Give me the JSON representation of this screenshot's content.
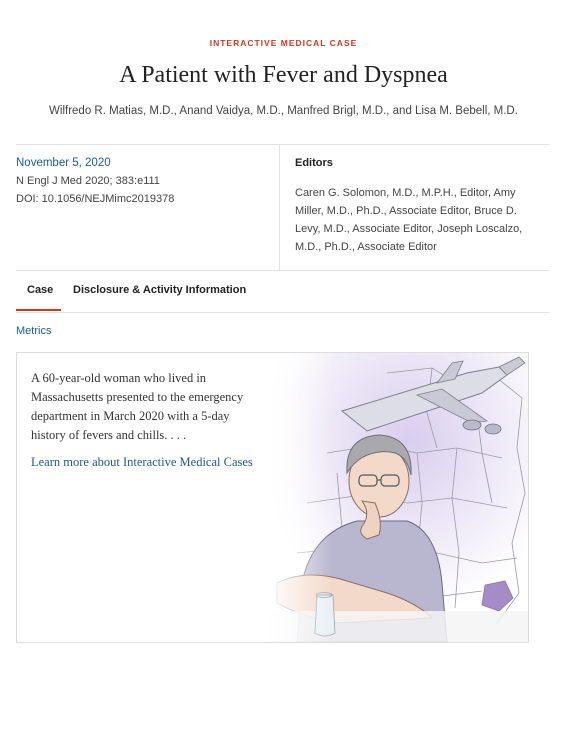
{
  "header": {
    "kicker": "INTERACTIVE MEDICAL CASE",
    "title": "A Patient with Fever and Dyspnea",
    "authors": "Wilfredo R. Matias, M.D., Anand Vaidya, M.D., Manfred Brigl, M.D., and Lisa M. Bebell, M.D."
  },
  "publication": {
    "date": "November 5, 2020",
    "citation": "N Engl J Med 2020; 383:e111",
    "doi": "DOI: 10.1056/NEJMimc2019378"
  },
  "editors": {
    "heading": "Editors",
    "list": "Caren G. Solomon, M.D., M.P.H., Editor, Amy Miller, M.D., Ph.D., Associate Editor, Bruce D. Levy, M.D., Associate Editor, Joseph Loscalzo, M.D., Ph.D., Associate Editor"
  },
  "tabs": [
    {
      "label": "Case",
      "active": true
    },
    {
      "label": "Disclosure & Activity Information",
      "active": false
    }
  ],
  "metrics_label": "Metrics",
  "case_card": {
    "summary": "A 60-year-old woman who lived in Massachusetts presented to the emergency department in March 2020 with a 5-day history of fevers and chills. . . .",
    "link": "Learn more about Interactive Medical Cases"
  },
  "colors": {
    "accent": "#d0391c",
    "link": "#1a5b94",
    "map_highlight": "#a58cc7"
  }
}
